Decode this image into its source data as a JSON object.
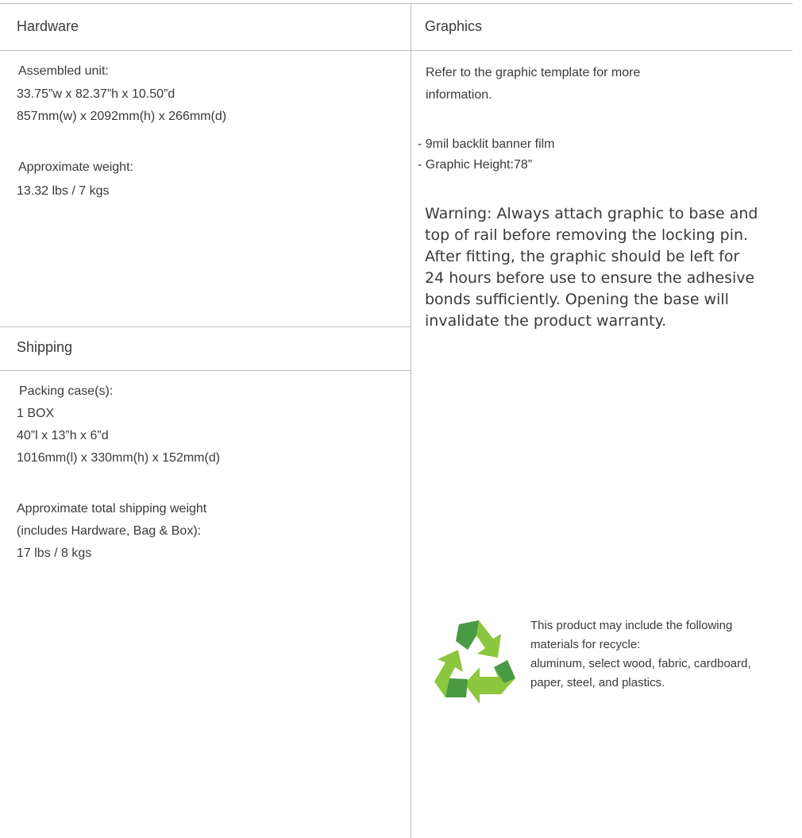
{
  "hardware": {
    "title": "Hardware",
    "assembled_label": "Assembled unit:",
    "dims_in": "33.75”w x 82.37”h x 10.50”d",
    "dims_mm": "857mm(w) x 2092mm(h) x 266mm(d)",
    "weight_label": "Approximate weight:",
    "weight_value": "13.32 lbs /  7 kgs"
  },
  "graphics": {
    "title": "Graphics",
    "refer_line1": "Refer to the graphic template for more",
    "refer_line2": "information.",
    "spec1": "- 9mil backlit banner film",
    "spec2": "- Graphic Height:78”",
    "warning_lines": [
      "Warning: Always attach graphic to base and",
      "top of rail before removing the locking pin.",
      "After fitting, the graphic should be left for",
      "24 hours before use to ensure the adhesive",
      "bonds sufficiently. Opening the base will",
      "invalidate the product warranty."
    ]
  },
  "shipping": {
    "title": "Shipping",
    "case_label": "Packing case(s):",
    "box_count": "1 BOX",
    "dims_in": "40”l x 13”h x 6”d",
    "dims_mm": "1016mm(l) x 330mm(h) x 152mm(d)",
    "weight_label1": "Approximate total shipping weight",
    "weight_label2": "(includes Hardware, Bag & Box):",
    "weight_value": "17 lbs / 8 kgs"
  },
  "recycle": {
    "icon": "recycle-icon",
    "colors": {
      "dark": "#4a9a45",
      "light": "#8dc63f"
    },
    "lines": [
      "This product may include the following",
      "materials for recycle:",
      "aluminum, select wood, fabric, cardboard,",
      "paper, steel, and plastics."
    ]
  }
}
